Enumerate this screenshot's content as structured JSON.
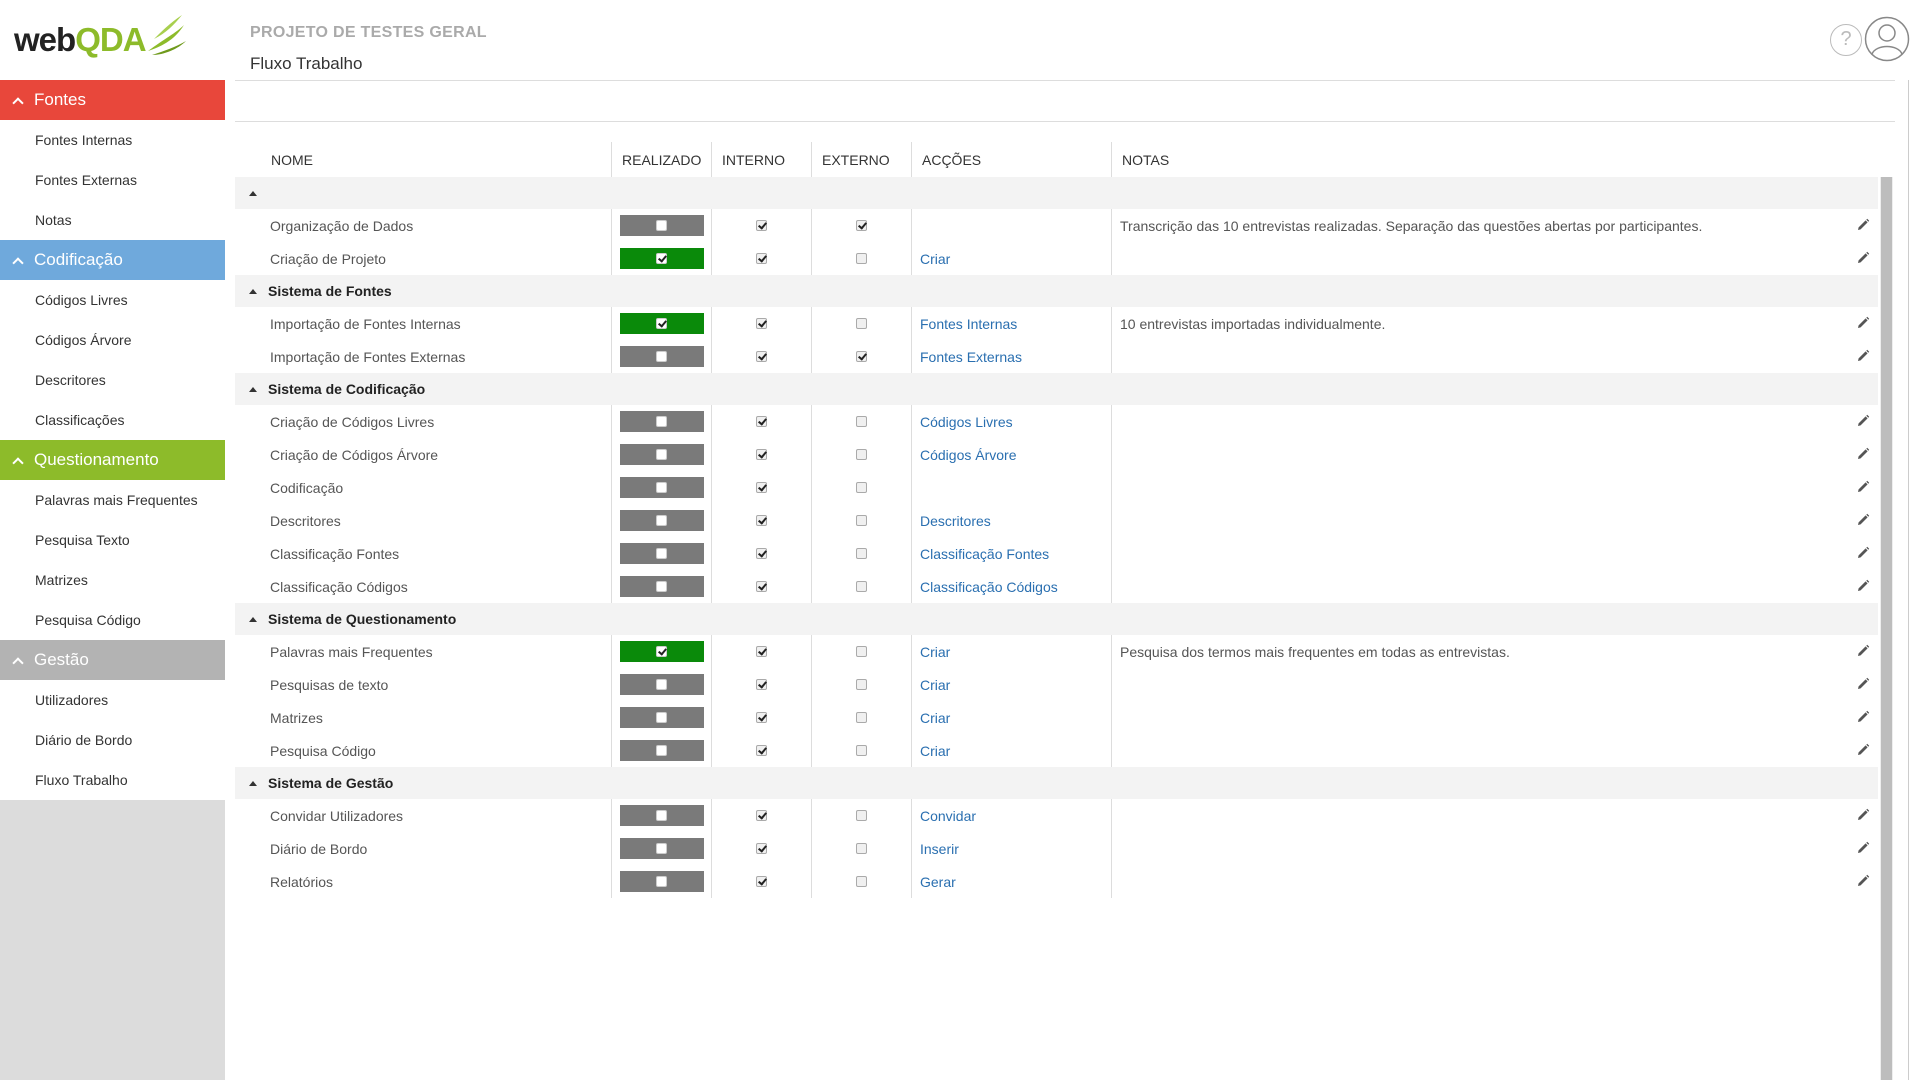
{
  "app": {
    "logo_web": "web",
    "logo_qda": "QDA"
  },
  "sidebar": {
    "sections": [
      {
        "label": "Fontes",
        "color": "#e8473b",
        "items": [
          "Fontes Internas",
          "Fontes Externas",
          "Notas"
        ]
      },
      {
        "label": "Codificação",
        "color": "#6fa9dc",
        "items": [
          "Códigos Livres",
          "Códigos Árvore",
          "Descritores",
          "Classificações"
        ]
      },
      {
        "label": "Questionamento",
        "color": "#8dbb2a",
        "items": [
          "Palavras mais Frequentes",
          "Pesquisa Texto",
          "Matrizes",
          "Pesquisa Código"
        ]
      },
      {
        "label": "Gestão",
        "color": "#b3b3b3",
        "items": [
          "Utilizadores",
          "Diário de Bordo",
          "Fluxo Trabalho"
        ]
      }
    ]
  },
  "header": {
    "project": "PROJETO DE TESTES GERAL",
    "page": "Fluxo Trabalho",
    "help": "?"
  },
  "grid": {
    "columns": [
      "NOME",
      "REALIZADO",
      "INTERNO",
      "EXTERNO",
      "ACÇÕES",
      "NOTAS"
    ],
    "groups": [
      {
        "title": "",
        "rows": [
          {
            "name": "Organização de Dados",
            "done": false,
            "internal": true,
            "external": true,
            "action": "",
            "note": "Transcrição das 10 entrevistas realizadas. Separação das questões abertas por participantes."
          },
          {
            "name": "Criação de Projeto",
            "done": true,
            "internal": true,
            "external": false,
            "action": "Criar",
            "note": ""
          }
        ]
      },
      {
        "title": "Sistema de Fontes",
        "rows": [
          {
            "name": "Importação de Fontes Internas",
            "done": true,
            "internal": true,
            "external": false,
            "action": "Fontes Internas",
            "note": "10 entrevistas importadas individualmente."
          },
          {
            "name": "Importação de Fontes Externas",
            "done": false,
            "internal": true,
            "external": true,
            "action": "Fontes Externas",
            "note": ""
          }
        ]
      },
      {
        "title": "Sistema de Codificação",
        "rows": [
          {
            "name": "Criação de Códigos Livres",
            "done": false,
            "internal": true,
            "external": false,
            "action": "Códigos Livres",
            "note": ""
          },
          {
            "name": "Criação de Códigos Árvore",
            "done": false,
            "internal": true,
            "external": false,
            "action": "Códigos Árvore",
            "note": ""
          },
          {
            "name": "Codificação",
            "done": false,
            "internal": true,
            "external": false,
            "action": "",
            "note": ""
          },
          {
            "name": "Descritores",
            "done": false,
            "internal": true,
            "external": false,
            "action": "Descritores",
            "note": ""
          },
          {
            "name": "Classificação Fontes",
            "done": false,
            "internal": true,
            "external": false,
            "action": "Classificação Fontes",
            "note": ""
          },
          {
            "name": "Classificação Códigos",
            "done": false,
            "internal": true,
            "external": false,
            "action": "Classificação Códigos",
            "note": ""
          }
        ]
      },
      {
        "title": "Sistema de Questionamento",
        "rows": [
          {
            "name": "Palavras mais Frequentes",
            "done": true,
            "internal": true,
            "external": false,
            "action": "Criar",
            "note": "Pesquisa dos termos mais frequentes em todas as entrevistas."
          },
          {
            "name": "Pesquisas de texto",
            "done": false,
            "internal": true,
            "external": false,
            "action": "Criar",
            "note": ""
          },
          {
            "name": "Matrizes",
            "done": false,
            "internal": true,
            "external": false,
            "action": "Criar",
            "note": ""
          },
          {
            "name": "Pesquisa Código",
            "done": false,
            "internal": true,
            "external": false,
            "action": "Criar",
            "note": ""
          }
        ]
      },
      {
        "title": "Sistema de Gestão",
        "rows": [
          {
            "name": "Convidar Utilizadores",
            "done": false,
            "internal": true,
            "external": false,
            "action": "Convidar",
            "note": ""
          },
          {
            "name": "Diário de Bordo",
            "done": false,
            "internal": true,
            "external": false,
            "action": "Inserir",
            "note": ""
          },
          {
            "name": "Relatórios",
            "done": false,
            "internal": true,
            "external": false,
            "action": "Gerar",
            "note": ""
          }
        ]
      }
    ]
  }
}
